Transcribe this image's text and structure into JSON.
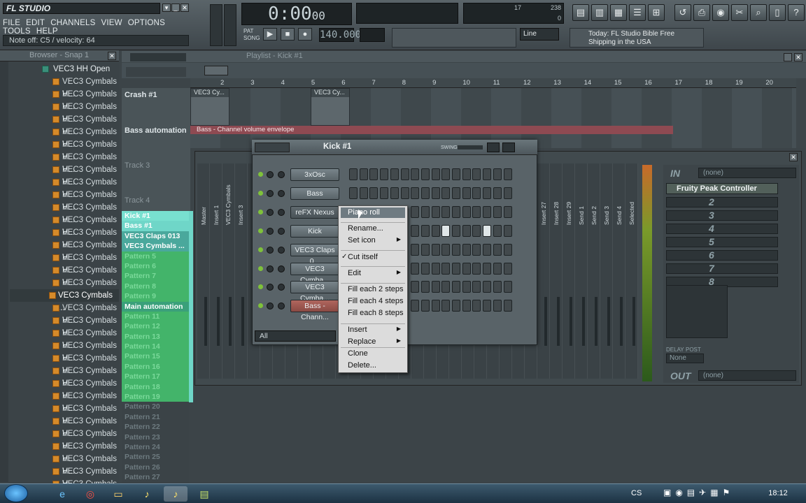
{
  "app": {
    "title": "FL STUDIO",
    "hint": "Note off: C5 / velocity: 64",
    "menus": [
      "FILE",
      "EDIT",
      "CHANNELS",
      "VIEW",
      "OPTIONS",
      "TOOLS",
      "HELP"
    ]
  },
  "transport": {
    "time_main": "0:00",
    "time_ms": "00",
    "tempo": "140.000",
    "snap": "Line",
    "pat": "PAT",
    "song": "SONG"
  },
  "cpu": {
    "value1": "17",
    "value2": "238",
    "value3": "0"
  },
  "news": {
    "line1": "Today: FL Studio Bible Free",
    "line2": "Shipping in the USA"
  },
  "browser": {
    "title": "Browser - Snap 1",
    "folder": "VEC3 HH Open",
    "items": [
      "VEC3 Cymbals H...",
      "VEC3 Cymbals H...",
      "VEC3 Cymbals H...",
      "VEC3 Cymbals H...",
      "VEC3 Cymbals H...",
      "VEC3 Cymbals H...",
      "VEC3 Cymbals H...",
      "VEC3 Cymbals H...",
      "VEC3 Cymbals H...",
      "VEC3 Cymbals H...",
      "VEC3 Cymbals H...",
      "VEC3 Cymbals H...",
      "VEC3 Cymbals H...",
      "VEC3 Cymbals H...",
      "VEC3 Cymbals H...",
      "VEC3 Cymbals H...",
      "VEC3 Cymbals H...",
      "VEC3 Cymbals H...",
      "VEC3 Cymbals H...",
      "VEC3 Cymbals H...",
      "VEC3 Cymbals H...",
      "VEC3 Cymbals H...",
      "VEC3 Cymbals H...",
      "VEC3 Cymbals H...",
      "VEC3 Cymbals H...",
      "VEC3 Cymbals H...",
      "VEC3 Cymbals H...",
      "VEC3 Cymbals H...",
      "VEC3 Cymbals H...",
      "VEC3 Cymbals H...",
      "VEC3 Cymbals H...",
      "VEC3 Cymbals H...",
      "VEC3 Cymbals H...",
      "VEC3 Cymbals H..."
    ],
    "selected_item": "VEC3 Cymbals ..."
  },
  "patterns": [
    "Kick #1",
    "Bass #1",
    "VEC3 Claps 013",
    "VEC3 Cymbals ...",
    "Pattern 5",
    "Pattern 6",
    "Pattern 7",
    "Pattern 8",
    "Pattern 9",
    "Main automation",
    "Pattern 11",
    "Pattern 12",
    "Pattern 13",
    "Pattern 14",
    "Pattern 15",
    "Pattern 16",
    "Pattern 17",
    "Pattern 18",
    "Pattern 19",
    "Pattern 20",
    "Pattern 21",
    "Pattern 22",
    "Pattern 23",
    "Pattern 24",
    "Pattern 25",
    "Pattern 26",
    "Pattern 27"
  ],
  "playlist": {
    "title": "Playlist - Kick #1",
    "ruler": [
      "2",
      "3",
      "4",
      "5",
      "6",
      "7",
      "8",
      "9",
      "10",
      "11",
      "12",
      "13",
      "14",
      "15",
      "16",
      "17",
      "18",
      "19",
      "20"
    ],
    "tracks": [
      "Crash #1",
      "Bass automation",
      "Track 3",
      "Track 4"
    ],
    "clip1": "VEC3 Cy...",
    "clip2": "VEC3 Cy...",
    "automation": "Bass - Channel volume envelope"
  },
  "rack": {
    "title": "Kick #1",
    "swing": "SWING",
    "channels": [
      "3xOsc",
      "Bass",
      "reFX Nexus",
      "Kick",
      "VEC3 Claps 0...",
      "VEC3 Cymba...",
      "VEC3 Cymba...",
      "Bass - Chann..."
    ],
    "filter": "All"
  },
  "context_menu": {
    "items": [
      "Piano roll",
      "Rename...",
      "Set icon",
      "Cut itself",
      "Edit",
      "Fill each 2 steps",
      "Fill each 4 steps",
      "Fill each 8 steps",
      "Insert",
      "Replace",
      "Clone",
      "Delete..."
    ]
  },
  "mixer": {
    "strips": [
      "Master",
      "Insert 1",
      "VEC3 Cymbals",
      "Insert 3",
      "Insert 27",
      "Insert 28",
      "Insert 29",
      "Send 1",
      "Send 2",
      "Send 3",
      "Send 4",
      "Selected"
    ],
    "fx_title": "Fruity Peak Controller",
    "in_label": "IN",
    "in_value": "(none)",
    "out_label": "OUT",
    "out_value": "(none)",
    "slots": [
      "2",
      "3",
      "4",
      "5",
      "6",
      "7",
      "8"
    ],
    "delay": "DELAY",
    "post": "POST",
    "none": "None"
  },
  "taskbar": {
    "lang": "CS",
    "clock": "18:12"
  }
}
